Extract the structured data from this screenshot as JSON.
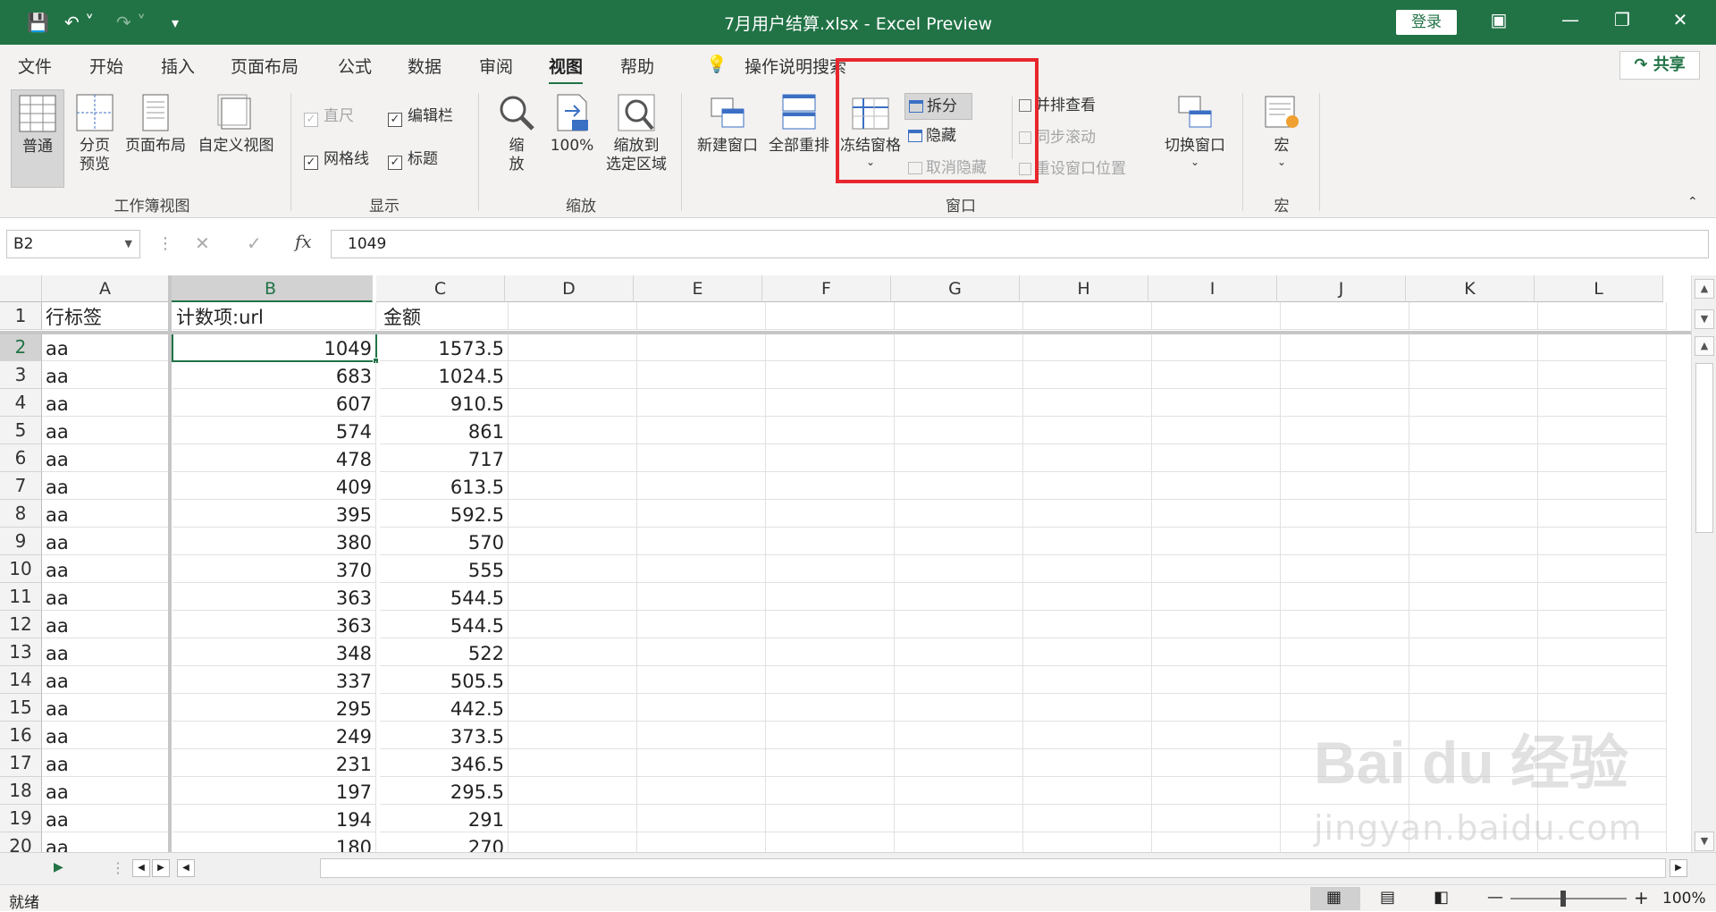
{
  "titlebar": {
    "title": "7月用户结算.xlsx  -  Excel Preview",
    "login": "登录",
    "save_icon": "save-icon",
    "undo_icon": "undo-icon",
    "redo_icon": "redo-icon"
  },
  "tabs": [
    "文件",
    "开始",
    "插入",
    "页面布局",
    "公式",
    "数据",
    "审阅",
    "视图",
    "帮助"
  ],
  "active_tab": "视图",
  "tell_me": "操作说明搜索",
  "share": "共享",
  "ribbon": {
    "workbook_views": {
      "label": "工作簿视图",
      "normal": "普通",
      "page_break_1": "分页",
      "page_break_2": "预览",
      "page_layout": "页面布局",
      "custom_views": "自定义视图"
    },
    "show": {
      "label": "显示",
      "ruler": "直尺",
      "formula_bar": "编辑栏",
      "gridlines": "网格线",
      "headings": "标题"
    },
    "zoom": {
      "label": "缩放",
      "zoom_1": "缩",
      "zoom_2": "放",
      "zoom100": "100%",
      "zoom_sel_1": "缩放到",
      "zoom_sel_2": "选定区域"
    },
    "window": {
      "label": "窗口",
      "new_window": "新建窗口",
      "arrange_all": "全部重排",
      "freeze_panes": "冻结窗格",
      "split": "拆分",
      "hide": "隐藏",
      "unhide": "取消隐藏",
      "side_by_side": "并排查看",
      "sync_scroll": "同步滚动",
      "reset_position": "重设窗口位置",
      "switch_windows": "切换窗口"
    },
    "macros": {
      "label": "宏",
      "macros": "宏"
    }
  },
  "formula_bar": {
    "name_box": "B2",
    "value": "1049"
  },
  "columns": [
    "A",
    "B",
    "C",
    "D",
    "E",
    "F",
    "G",
    "H",
    "I",
    "J",
    "K",
    "L"
  ],
  "rows": [
    {
      "n": "1",
      "a": "行标签",
      "b": "计数项:url",
      "c": "金额"
    },
    {
      "n": "2",
      "a": "aa",
      "b": "1049",
      "c": "1573.5"
    },
    {
      "n": "3",
      "a": "aa",
      "b": "683",
      "c": "1024.5"
    },
    {
      "n": "4",
      "a": "aa",
      "b": "607",
      "c": "910.5"
    },
    {
      "n": "5",
      "a": "aa",
      "b": "574",
      "c": "861"
    },
    {
      "n": "6",
      "a": "aa",
      "b": "478",
      "c": "717"
    },
    {
      "n": "7",
      "a": "aa",
      "b": "409",
      "c": "613.5"
    },
    {
      "n": "8",
      "a": "aa",
      "b": "395",
      "c": "592.5"
    },
    {
      "n": "9",
      "a": "aa",
      "b": "380",
      "c": "570"
    },
    {
      "n": "10",
      "a": "aa",
      "b": "370",
      "c": "555"
    },
    {
      "n": "11",
      "a": "aa",
      "b": "363",
      "c": "544.5"
    },
    {
      "n": "12",
      "a": "aa",
      "b": "363",
      "c": "544.5"
    },
    {
      "n": "13",
      "a": "aa",
      "b": "348",
      "c": "522"
    },
    {
      "n": "14",
      "a": "aa",
      "b": "337",
      "c": "505.5"
    },
    {
      "n": "15",
      "a": "aa",
      "b": "295",
      "c": "442.5"
    },
    {
      "n": "16",
      "a": "aa",
      "b": "249",
      "c": "373.5"
    },
    {
      "n": "17",
      "a": "aa",
      "b": "231",
      "c": "346.5"
    },
    {
      "n": "18",
      "a": "aa",
      "b": "197",
      "c": "295.5"
    },
    {
      "n": "19",
      "a": "aa",
      "b": "194",
      "c": "291"
    },
    {
      "n": "20",
      "a": "aa",
      "b": "180",
      "c": "270"
    }
  ],
  "status": {
    "ready": "就绪",
    "zoom": "100%"
  },
  "watermark": {
    "line1": "Bai du 经验",
    "line2": "jingyan.baidu.com"
  },
  "colors": {
    "accent": "#217346",
    "highlight": "#e8262d"
  }
}
